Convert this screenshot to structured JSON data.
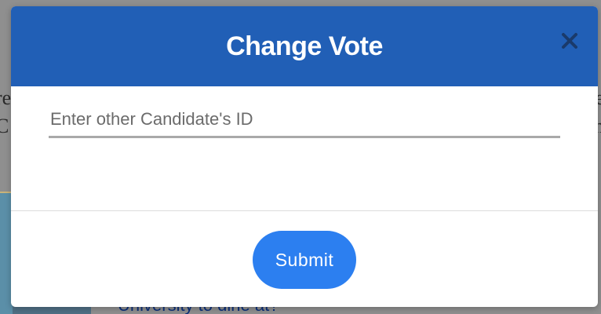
{
  "modal": {
    "title": "Change Vote",
    "close_icon": "close-icon",
    "candidate_input": {
      "placeholder": "Enter other Candidate's ID",
      "value": ""
    },
    "submit_label": "Submit"
  },
  "background": {
    "link_text": "University to dine at?"
  },
  "colors": {
    "header": "#215fb6",
    "submit": "#2c7ff0",
    "close_icon": "#1a3a6b"
  }
}
